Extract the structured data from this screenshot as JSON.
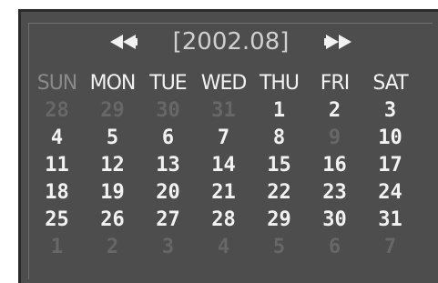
{
  "header": {
    "prev_icon": "double-left-arrow-icon",
    "title": "[2002.08]",
    "next_icon": "double-right-arrow-icon"
  },
  "weekdays": [
    "SUN",
    "MON",
    "TUE",
    "WED",
    "THU",
    "FRI",
    "SAT"
  ],
  "weeks": [
    [
      {
        "d": "28",
        "dim": true
      },
      {
        "d": "29",
        "dim": true
      },
      {
        "d": "30",
        "dim": true
      },
      {
        "d": "31",
        "dim": true
      },
      {
        "d": "1",
        "dim": false
      },
      {
        "d": "2",
        "dim": false
      },
      {
        "d": "3",
        "dim": false
      }
    ],
    [
      {
        "d": "4",
        "dim": false
      },
      {
        "d": "5",
        "dim": false
      },
      {
        "d": "6",
        "dim": false
      },
      {
        "d": "7",
        "dim": false
      },
      {
        "d": "8",
        "dim": false
      },
      {
        "d": "9",
        "dim": true
      },
      {
        "d": "10",
        "dim": false
      }
    ],
    [
      {
        "d": "11",
        "dim": false
      },
      {
        "d": "12",
        "dim": false
      },
      {
        "d": "13",
        "dim": false
      },
      {
        "d": "14",
        "dim": false
      },
      {
        "d": "15",
        "dim": false
      },
      {
        "d": "16",
        "dim": false
      },
      {
        "d": "17",
        "dim": false
      }
    ],
    [
      {
        "d": "18",
        "dim": false
      },
      {
        "d": "19",
        "dim": false
      },
      {
        "d": "20",
        "dim": false
      },
      {
        "d": "21",
        "dim": false
      },
      {
        "d": "22",
        "dim": false
      },
      {
        "d": "23",
        "dim": false
      },
      {
        "d": "24",
        "dim": false
      }
    ],
    [
      {
        "d": "25",
        "dim": false
      },
      {
        "d": "26",
        "dim": false
      },
      {
        "d": "27",
        "dim": false
      },
      {
        "d": "28",
        "dim": false
      },
      {
        "d": "29",
        "dim": false
      },
      {
        "d": "30",
        "dim": false
      },
      {
        "d": "31",
        "dim": false
      }
    ],
    [
      {
        "d": "1",
        "dim": true
      },
      {
        "d": "2",
        "dim": true
      },
      {
        "d": "3",
        "dim": true
      },
      {
        "d": "4",
        "dim": true
      },
      {
        "d": "5",
        "dim": true
      },
      {
        "d": "6",
        "dim": true
      },
      {
        "d": "7",
        "dim": true
      }
    ]
  ],
  "colors": {
    "background": "#4d4d4d",
    "text": "#f2f2f2",
    "dim_text": "#676767",
    "sunday_header": "#8a8a8a"
  }
}
